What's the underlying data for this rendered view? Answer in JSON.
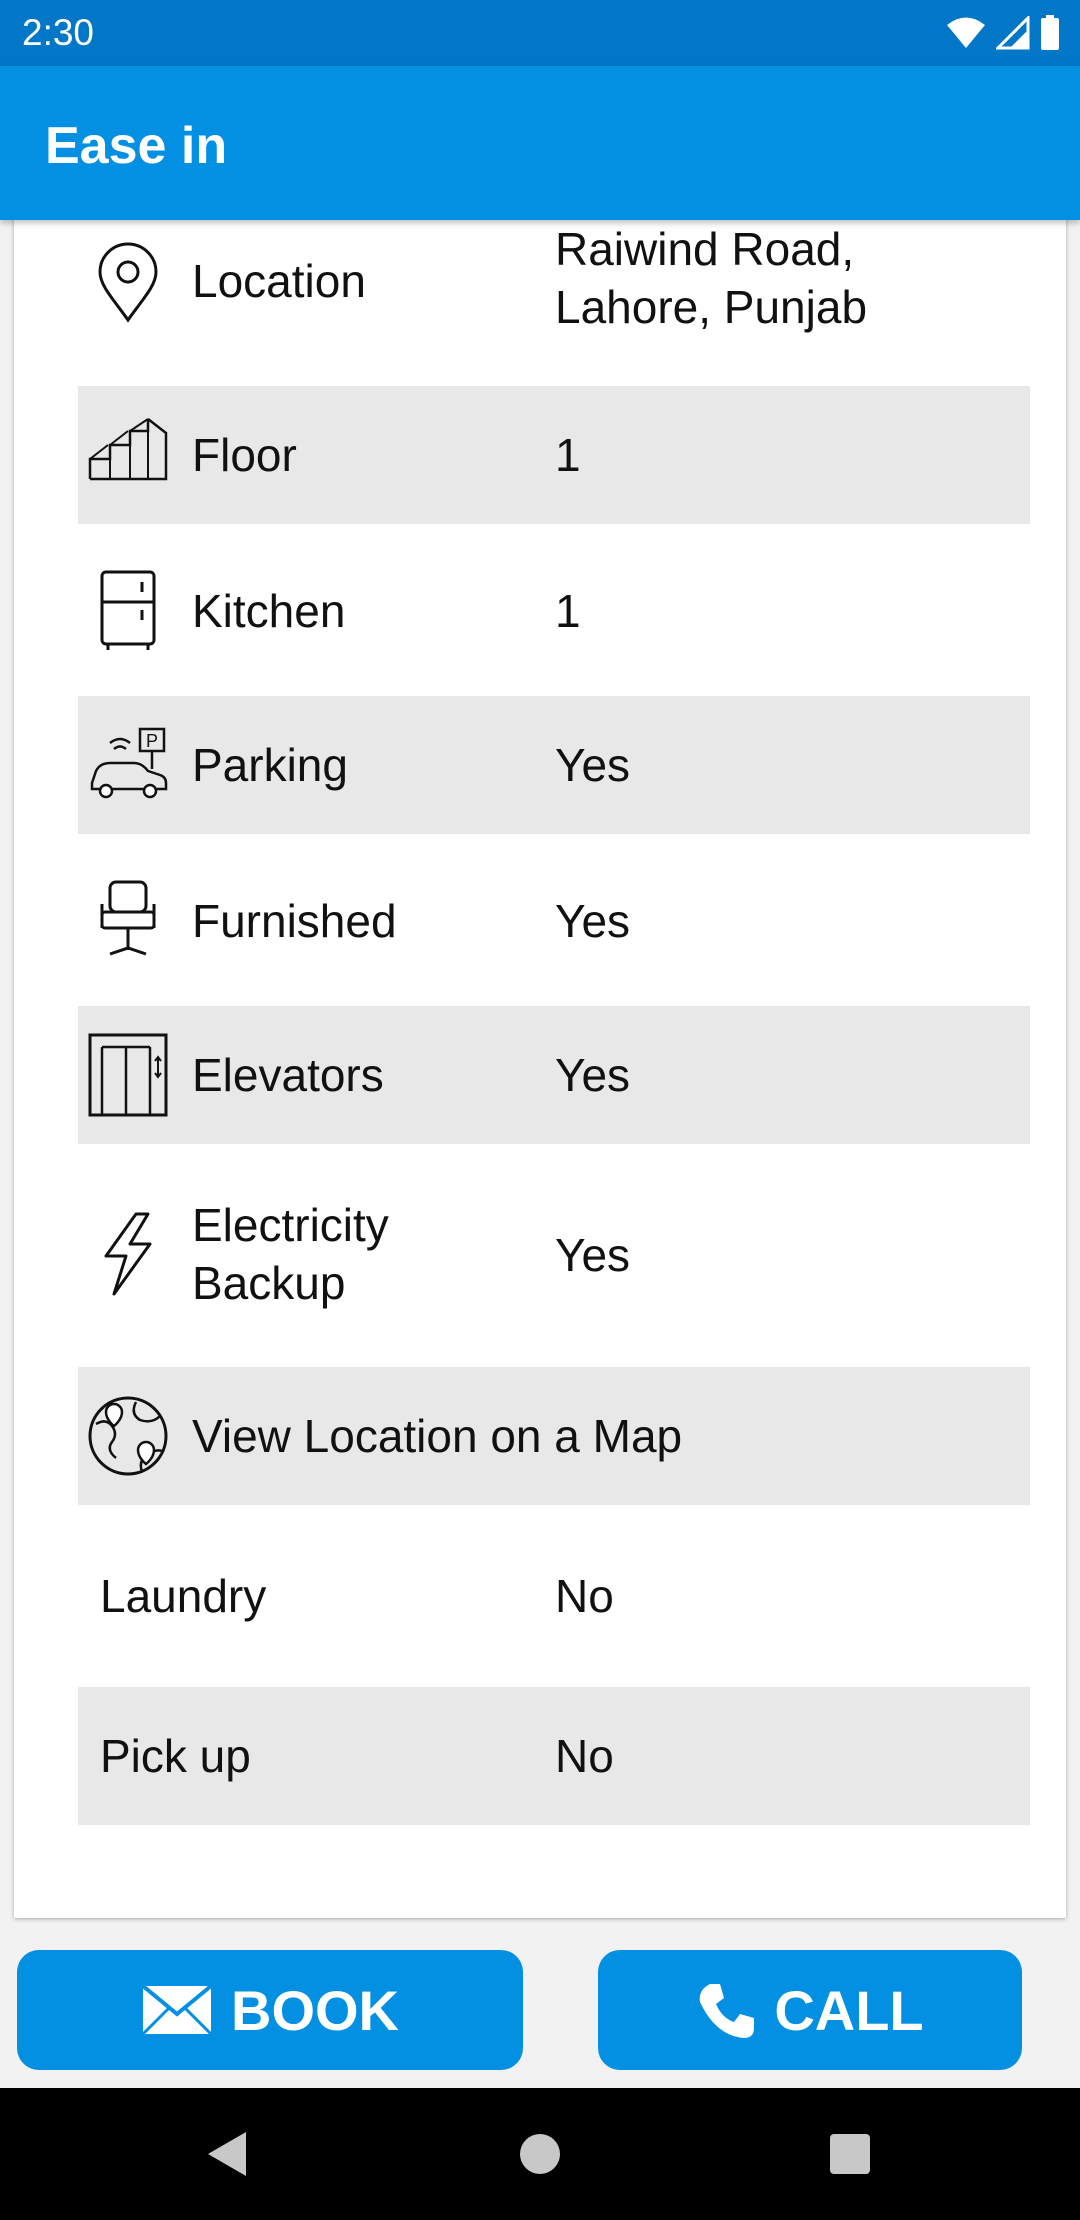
{
  "status_bar": {
    "time": "2:30"
  },
  "app_bar": {
    "title": "Ease in"
  },
  "details": {
    "location": {
      "label": "Location",
      "value_line1": "Raiwind Road,",
      "value_line2": "Lahore, Punjab"
    },
    "floor": {
      "label": "Floor",
      "value": "1"
    },
    "kitchen": {
      "label": "Kitchen",
      "value": "1"
    },
    "parking": {
      "label": "Parking",
      "value": "Yes"
    },
    "furnished": {
      "label": "Furnished",
      "value": "Yes"
    },
    "elevators": {
      "label": "Elevators",
      "value": "Yes"
    },
    "electricity_backup": {
      "label_line1": "Electricity",
      "label_line2": "Backup",
      "value": "Yes"
    },
    "map_link": {
      "label": "View Location on a Map"
    },
    "laundry": {
      "label": "Laundry",
      "value": "No"
    },
    "pick_up": {
      "label": "Pick up",
      "value": "No"
    }
  },
  "actions": {
    "book_label": "BOOK",
    "call_label": "CALL"
  },
  "icons": {
    "location": "map-pin-icon",
    "floor": "stairs-icon",
    "kitchen": "fridge-icon",
    "parking": "car-parking-icon",
    "furnished": "chair-icon",
    "elevators": "elevator-icon",
    "electricity": "lightning-icon",
    "map": "globe-map-icon",
    "book": "mail-icon",
    "call": "phone-icon"
  },
  "colors": {
    "primary": "#0390e3",
    "status_bar": "#0277c8",
    "row_shade": "#e8e8e8"
  }
}
